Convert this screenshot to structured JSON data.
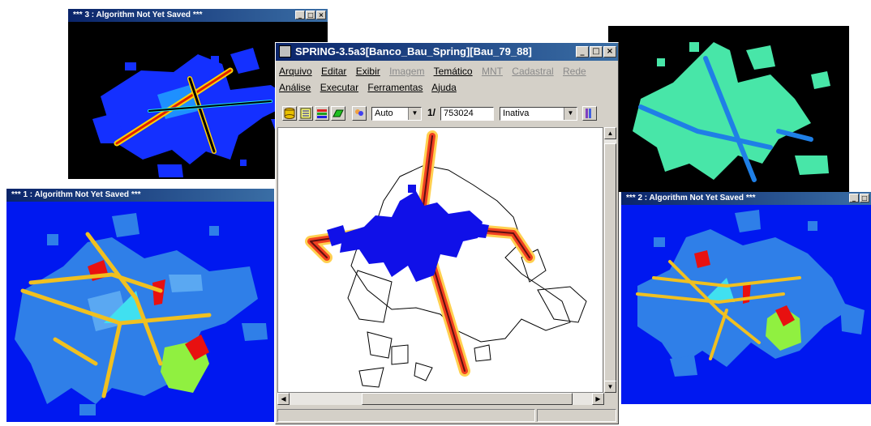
{
  "windows": {
    "win3": {
      "title": "*** 3 : Algorithm Not Yet Saved ***"
    },
    "win1": {
      "title": "*** 1 : Algorithm Not Yet Saved ***"
    },
    "win2": {
      "title": "*** 2 : Algorithm Not Yet Saved ***"
    }
  },
  "spring": {
    "title": "SPRING-3.5a3[Banco_Bau_Spring][Bau_79_88]",
    "menu_row1": [
      "Arquivo",
      "Editar",
      "Exibir",
      "Imagem",
      "Temático",
      "MNT",
      "Cadastral",
      "Rede"
    ],
    "menu_row1_disabled": [
      "Imagem",
      "MNT",
      "Cadastral",
      "Rede"
    ],
    "menu_row2": [
      "Análise",
      "Executar",
      "Ferramentas",
      "Ajuda"
    ],
    "toolbar": {
      "zoom_mode": "Auto",
      "scale_prefix": "1/",
      "scale_value": "753024",
      "status_select": "Inativa"
    }
  },
  "colors": {
    "title_gradient_start": "#0a246a",
    "title_gradient_end": "#3a6ea5",
    "map_background_blue": "#0018f0",
    "urban_blue": "#1f7fe6",
    "road_yellow": "#f0c020",
    "highlight_red": "#e81010",
    "green_patch": "#90f040",
    "teal_patch": "#48e6a8"
  }
}
